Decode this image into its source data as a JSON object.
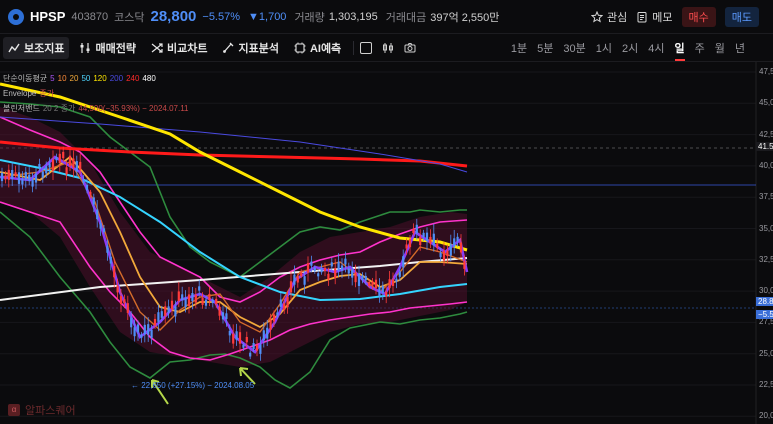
{
  "header": {
    "ticker": "HPSP",
    "code": "403870",
    "market": "코스닥",
    "price": "28,800",
    "change_pct": "−5.57%",
    "change_abs": "▼1,700",
    "volume_label": "거래량",
    "volume_value": "1,303,195",
    "amount_label": "거래대금",
    "amount_value": "397억 2,550만",
    "watch_label": "관심",
    "memo_label": "메모",
    "buy_label": "매수",
    "sell_label": "매도"
  },
  "toolbar": {
    "indicators_label": "보조지표",
    "strategy_label": "매매전략",
    "compare_label": "비교차트",
    "analysis_label": "지표분석",
    "ai_label": "AI예측",
    "timeframes": [
      "1분",
      "5분",
      "30분",
      "1시",
      "2시",
      "4시",
      "일",
      "주",
      "월",
      "년"
    ],
    "active_timeframe": "일"
  },
  "legend": {
    "ma_label": "단순이동평균",
    "ma_periods": [
      "5",
      "10",
      "20",
      "50",
      "120",
      "200",
      "240",
      "480"
    ],
    "ma_colors": [
      "#a855f7",
      "#ff8c3a",
      "#f2a93b",
      "#4fd6ff",
      "#ffe600",
      "#4a4ae0",
      "#ff2a2a",
      "#ffffff"
    ],
    "envelope_label": "Envelope",
    "envelope_extra": "종가",
    "bb_label": "볼린저밴드",
    "bb_params": "20 2 종가",
    "bb_high_note": "44,500(−35.93%) − 2024.07.11"
  },
  "chart": {
    "low_annotation": "← 22,650 (+27.15%) − 2024.08.05",
    "price_tags": [
      {
        "text": "41.5",
        "color": "#1a1a1e"
      },
      {
        "text": "28.8",
        "color": "#3b6fd8"
      },
      {
        "text": "−5.5",
        "color": "#3b6fd8"
      }
    ],
    "y_ticks": [
      "47,500",
      "45,000",
      "42,500",
      "40,000",
      "37,500",
      "35,000",
      "32,500",
      "30,000",
      "27,500",
      "25,000",
      "22,500",
      "20,000"
    ]
  },
  "watermark": "알파스퀘어"
}
